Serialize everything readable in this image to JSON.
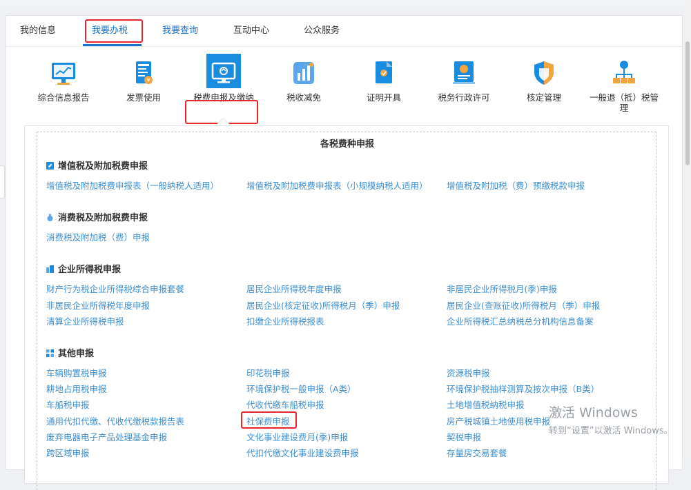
{
  "tabs": [
    {
      "label": "我的信息"
    },
    {
      "label": "我要办税"
    },
    {
      "label": "我要查询"
    },
    {
      "label": "互动中心"
    },
    {
      "label": "公众服务"
    }
  ],
  "categories": [
    {
      "label": "综合信息报告",
      "icon": "monitor-chart-icon"
    },
    {
      "label": "发票使用",
      "icon": "invoice-icon"
    },
    {
      "label": "税费申报及缴纳",
      "icon": "tax-declare-icon"
    },
    {
      "label": "税收减免",
      "icon": "bar-chart-icon"
    },
    {
      "label": "证明开具",
      "icon": "certificate-icon"
    },
    {
      "label": "税务行政许可",
      "icon": "license-icon"
    },
    {
      "label": "核定管理",
      "icon": "shield-icon"
    },
    {
      "label": "一般退（抵）税管理",
      "icon": "org-tree-icon"
    }
  ],
  "panel": {
    "title": "各税费种申报",
    "sections": [
      {
        "title": "增值税及附加税费申报",
        "links": [
          [
            "增值税及附加税费申报表（一般纳税人适用）",
            "增值税及附加税费申报表（小规模纳税人适用）",
            "增值税及附加税（费）预缴税款申报"
          ]
        ]
      },
      {
        "title": "消费税及附加税费申报",
        "links": [
          [
            "消费税及附加税（费）申报"
          ]
        ]
      },
      {
        "title": "企业所得税申报",
        "links": [
          [
            "财产行为税企业所得税综合申报套餐",
            "居民企业所得税年度申报",
            "非居民企业所得税月(季)申报"
          ],
          [
            "非居民企业所得税年度申报",
            "居民企业(核定征收)所得税月（季）申报",
            "居民企业(查账征收)所得税月（季）申报"
          ],
          [
            "清算企业所得税申报",
            "扣缴企业所得税报表",
            "企业所得税汇总纳税总分机构信息备案"
          ]
        ]
      },
      {
        "title": "其他申报",
        "links": [
          [
            "车辆购置税申报",
            "印花税申报",
            "资源税申报"
          ],
          [
            "耕地占用税申报",
            "环境保护税一般申报（A类）",
            "环境保护税抽样测算及按次申报（B类）"
          ],
          [
            "车船税申报",
            "代收代缴车船税申报",
            "土地增值税纳税申报"
          ],
          [
            "通用代扣代缴、代收代缴税款报告表",
            "社保费申报",
            "房产税城镇土地使用税申报"
          ],
          [
            "废弃电器电子产品处理基金申报",
            "文化事业建设费月(季)申报",
            "契税申报"
          ],
          [
            "跨区域申报",
            "代扣代缴文化事业建设费申报",
            "存量房交易套餐"
          ]
        ]
      }
    ]
  },
  "watermark": {
    "line1": "激活 Windows",
    "line2": "转到“设置”以激活 Windows。"
  },
  "colors": {
    "accent": "#1a73c8",
    "link": "#3d8fd1",
    "highlight": "#e8242c"
  }
}
